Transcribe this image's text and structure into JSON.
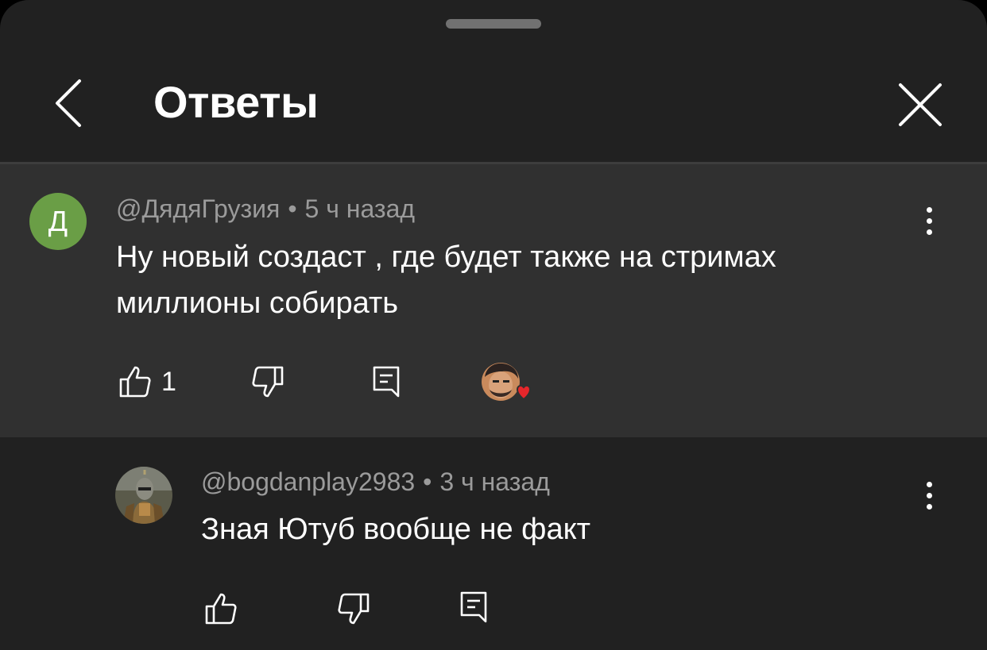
{
  "header": {
    "title": "Ответы",
    "back_icon": "chevron-left-icon",
    "close_icon": "close-icon"
  },
  "parent_comment": {
    "avatar_letter": "Д",
    "avatar_color": "#6a9e46",
    "author": "@ДядяГрузия",
    "separator": "•",
    "time": "5 ч назад",
    "text_line1": "Ну новый создаст , где будет также на стримах",
    "text_line2": "миллионы собирать",
    "likes": "1",
    "creator_heart": true,
    "icons": [
      "thumb-up-icon",
      "thumb-down-icon",
      "reply-icon",
      "creator-heart-icon",
      "more-vert-icon"
    ]
  },
  "reply_comment": {
    "author": "@bogdanplay2983",
    "separator": "•",
    "time": "3 ч назад",
    "text": "Зная Ютуб вообще не факт",
    "icons": [
      "thumb-up-icon",
      "thumb-down-icon",
      "reply-icon",
      "more-vert-icon"
    ]
  },
  "colors": {
    "sheet_bg": "#212121",
    "highlight_bg": "#303030",
    "meta_text": "#9b9b9b",
    "heart": "#e5262b"
  }
}
